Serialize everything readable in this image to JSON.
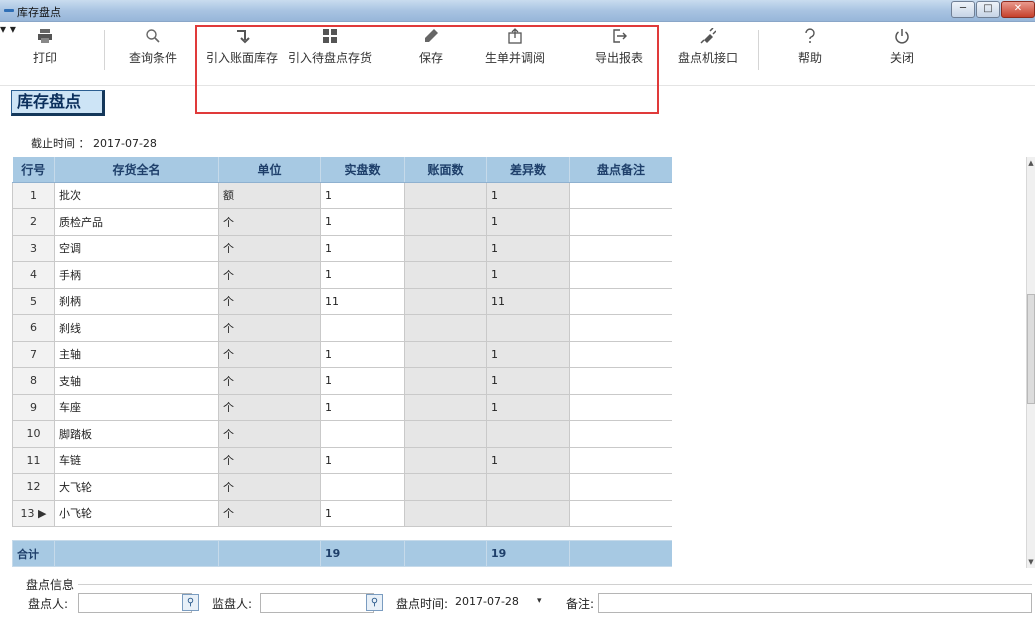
{
  "window": {
    "title": "库存盘点",
    "min_glyph": "─",
    "max_glyph": "□",
    "close_glyph": "✕"
  },
  "toolbar": {
    "print": "打印",
    "query": "查询条件",
    "import_book": "引入账面库存",
    "import_pending": "引入待盘点存货",
    "save": "保存",
    "gen_adjust": "生单并调阅",
    "export": "导出报表",
    "device": "盘点机接口",
    "help": "帮助",
    "close": "关闭",
    "dropdown_glyph": "▾"
  },
  "header": {
    "badge": "库存盘点",
    "cutoff": "截止时间 ： 2017-07-28"
  },
  "table": {
    "columns": [
      "行号",
      "存货全名",
      "单位",
      "实盘数",
      "账面数",
      "差异数",
      "盘点备注"
    ],
    "rows": [
      {
        "no": "1",
        "name": "批次",
        "unit": "额",
        "actual": "1",
        "book": "",
        "diff": "1",
        "note": ""
      },
      {
        "no": "2",
        "name": "质检产品",
        "unit": "个",
        "actual": "1",
        "book": "",
        "diff": "1",
        "note": ""
      },
      {
        "no": "3",
        "name": "空调",
        "unit": "个",
        "actual": "1",
        "book": "",
        "diff": "1",
        "note": ""
      },
      {
        "no": "4",
        "name": "手柄",
        "unit": "个",
        "actual": "1",
        "book": "",
        "diff": "1",
        "note": ""
      },
      {
        "no": "5",
        "name": "刹柄",
        "unit": "个",
        "actual": "11",
        "book": "",
        "diff": "11",
        "note": ""
      },
      {
        "no": "6",
        "name": "刹线",
        "unit": "个",
        "actual": "",
        "book": "",
        "diff": "",
        "note": ""
      },
      {
        "no": "7",
        "name": "主轴",
        "unit": "个",
        "actual": "1",
        "book": "",
        "diff": "1",
        "note": ""
      },
      {
        "no": "8",
        "name": "支轴",
        "unit": "个",
        "actual": "1",
        "book": "",
        "diff": "1",
        "note": ""
      },
      {
        "no": "9",
        "name": "车座",
        "unit": "个",
        "actual": "1",
        "book": "",
        "diff": "1",
        "note": ""
      },
      {
        "no": "10",
        "name": "脚踏板",
        "unit": "个",
        "actual": "",
        "book": "",
        "diff": "",
        "note": ""
      },
      {
        "no": "11",
        "name": "车链",
        "unit": "个",
        "actual": "1",
        "book": "",
        "diff": "1",
        "note": ""
      },
      {
        "no": "12",
        "name": "大飞轮",
        "unit": "个",
        "actual": "",
        "book": "",
        "diff": "",
        "note": ""
      },
      {
        "no": "13 ▶",
        "name": "小飞轮",
        "unit": "个",
        "actual": "1",
        "book": "",
        "diff": "",
        "note": ""
      }
    ],
    "total": {
      "label": "合计",
      "actual": "19",
      "diff": "19"
    }
  },
  "footer": {
    "group": "盘点信息",
    "counter_label": "盘点人:",
    "counter_value": "",
    "supervisor_label": "监盘人:",
    "supervisor_value": "",
    "time_label": "盘点时间:",
    "time_value": "2017-07-28",
    "note_label": "备注:",
    "note_value": "",
    "search_glyph": "🔍"
  },
  "colors": {
    "header_blue": "#a7c9e3",
    "highlight_red": "#e03a3a"
  }
}
